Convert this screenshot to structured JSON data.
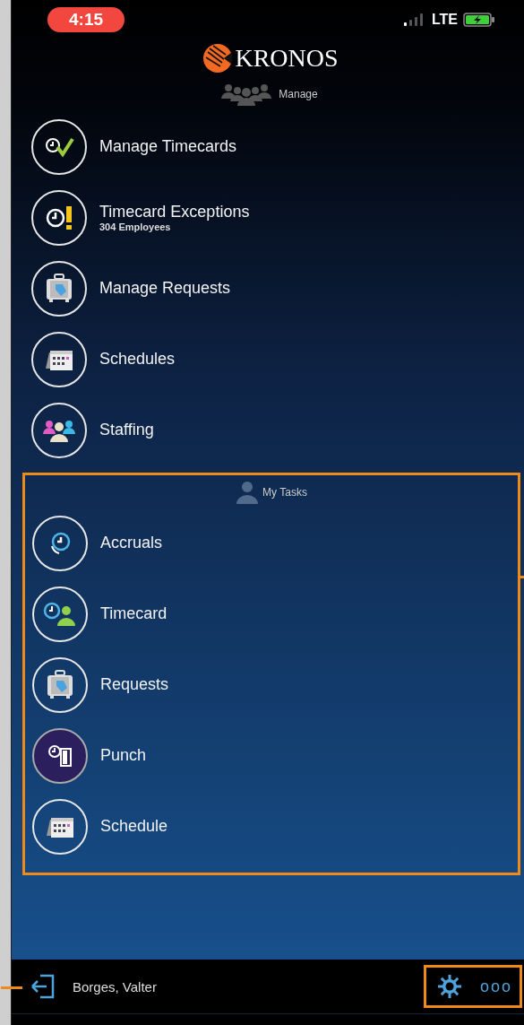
{
  "status_bar": {
    "time": "4:15",
    "network": "LTE"
  },
  "logo": {
    "text": "KRONOS"
  },
  "sections": [
    {
      "title": "Manage",
      "kind": "group",
      "highlighted": false,
      "items": [
        {
          "label": "Manage Timecards",
          "kind": "clock-check",
          "selected": false
        },
        {
          "label": "Timecard Exceptions",
          "subtitle": "304 Employees",
          "kind": "clock-alert",
          "selected": false
        },
        {
          "label": "Manage Requests",
          "kind": "luggage",
          "selected": false
        },
        {
          "label": "Schedules",
          "kind": "calendar",
          "selected": false
        },
        {
          "label": "Staffing",
          "kind": "people",
          "selected": false
        }
      ]
    },
    {
      "title": "My Tasks",
      "kind": "person",
      "highlighted": true,
      "items": [
        {
          "label": "Accruals",
          "kind": "clock",
          "selected": false
        },
        {
          "label": "Timecard",
          "kind": "clock-person",
          "selected": false
        },
        {
          "label": "Requests",
          "kind": "luggage",
          "selected": false
        },
        {
          "label": "Punch",
          "kind": "clock-door",
          "selected": true
        },
        {
          "label": "Schedule",
          "kind": "calendar",
          "selected": false
        }
      ]
    }
  ],
  "footer": {
    "user": "Borges, Valter",
    "more": "ooo"
  }
}
